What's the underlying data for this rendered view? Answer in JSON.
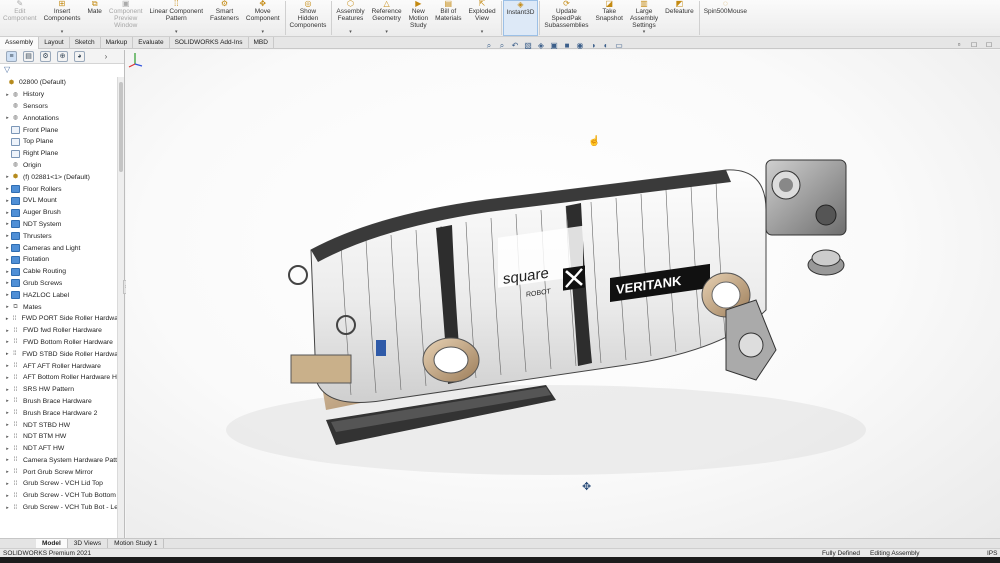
{
  "ribbon": {
    "buttons": [
      {
        "label": "Edit\nComponent",
        "icon": "edit-component-icon",
        "disabled": true
      },
      {
        "label": "Insert\nComponents",
        "icon": "insert-components-icon",
        "disabled": false,
        "dropdown": true
      },
      {
        "label": "Mate",
        "icon": "mate-icon",
        "disabled": false
      },
      {
        "label": "Component\nPreview\nWindow",
        "icon": "component-preview-icon",
        "disabled": true
      },
      {
        "label": "Linear Component\nPattern",
        "icon": "linear-pattern-icon",
        "disabled": false,
        "dropdown": true
      },
      {
        "label": "Smart\nFasteners",
        "icon": "smart-fasteners-icon",
        "disabled": false
      },
      {
        "label": "Move\nComponent",
        "icon": "move-component-icon",
        "disabled": false,
        "dropdown": true
      },
      {
        "label": "Show\nHidden\nComponents",
        "icon": "show-hidden-icon",
        "disabled": false
      },
      {
        "label": "Assembly\nFeatures",
        "icon": "assembly-features-icon",
        "disabled": false,
        "dropdown": true
      },
      {
        "label": "Reference\nGeometry",
        "icon": "reference-geometry-icon",
        "disabled": false,
        "dropdown": true
      },
      {
        "label": "New\nMotion\nStudy",
        "icon": "motion-study-icon",
        "disabled": false
      },
      {
        "label": "Bill of\nMaterials",
        "icon": "bill-of-materials-icon",
        "disabled": false
      },
      {
        "label": "Exploded\nView",
        "icon": "exploded-view-icon",
        "disabled": false,
        "dropdown": true
      },
      {
        "label": "Instant3D",
        "icon": "instant3d-icon",
        "disabled": false,
        "active": true
      },
      {
        "label": "Update\nSpeedPak\nSubassemblies",
        "icon": "speedpak-icon",
        "disabled": false
      },
      {
        "label": "Take\nSnapshot",
        "icon": "snapshot-icon",
        "disabled": false
      },
      {
        "label": "Large\nAssembly\nSettings",
        "icon": "large-assembly-icon",
        "disabled": false,
        "dropdown": true
      },
      {
        "label": "Defeature",
        "icon": "defeature-icon",
        "disabled": false
      },
      {
        "label": "Spin500Mouse",
        "icon": "spin-mouse-icon",
        "disabled": false
      }
    ]
  },
  "command_tabs": [
    "Assembly",
    "Layout",
    "Sketch",
    "Markup",
    "Evaluate",
    "SOLIDWORKS Add-Ins",
    "MBD"
  ],
  "active_command_tab": "Assembly",
  "feature_tree": {
    "nodes": [
      {
        "label": "02800  (Default)",
        "icon": "assembly-icon",
        "kind": "part",
        "expand": false
      },
      {
        "label": "History",
        "icon": "history-icon",
        "kind": "feat",
        "expand": true
      },
      {
        "label": "Sensors",
        "icon": "sensors-icon",
        "kind": "feat",
        "expand": false
      },
      {
        "label": "Annotations",
        "icon": "annotations-icon",
        "kind": "feat",
        "expand": true
      },
      {
        "label": "Front Plane",
        "icon": "plane-icon",
        "kind": "plane",
        "expand": false
      },
      {
        "label": "Top Plane",
        "icon": "plane-icon",
        "kind": "plane",
        "expand": false
      },
      {
        "label": "Right Plane",
        "icon": "plane-icon",
        "kind": "plane",
        "expand": false
      },
      {
        "label": "Origin",
        "icon": "origin-icon",
        "kind": "feat",
        "expand": false
      },
      {
        "label": "(f) 02881<1> (Default)",
        "icon": "part-icon",
        "kind": "part",
        "expand": true
      },
      {
        "label": "Floor Rollers",
        "icon": "folder-icon",
        "kind": "folder",
        "expand": true
      },
      {
        "label": "DVL Mount",
        "icon": "folder-icon",
        "kind": "folder",
        "expand": true
      },
      {
        "label": "Auger Brush",
        "icon": "folder-icon",
        "kind": "folder",
        "expand": true
      },
      {
        "label": "NDT System",
        "icon": "folder-icon",
        "kind": "folder",
        "expand": true
      },
      {
        "label": "Thrusters",
        "icon": "folder-icon",
        "kind": "folder",
        "expand": true
      },
      {
        "label": "Cameras and Light",
        "icon": "folder-icon",
        "kind": "folder",
        "expand": true
      },
      {
        "label": "Flotation",
        "icon": "folder-icon",
        "kind": "folder",
        "expand": true
      },
      {
        "label": "Cable Routing",
        "icon": "folder-icon",
        "kind": "folder",
        "expand": true
      },
      {
        "label": "Grub Screws",
        "icon": "folder-icon",
        "kind": "folder",
        "expand": true
      },
      {
        "label": "HAZLOC Label",
        "icon": "folder-icon",
        "kind": "folder",
        "expand": true
      },
      {
        "label": "Mates",
        "icon": "mates-icon",
        "kind": "mate",
        "expand": true
      },
      {
        "label": "FWD PORT Side Roller Hardwa",
        "icon": "pattern-icon",
        "kind": "pattern",
        "expand": true
      },
      {
        "label": "FWD fwd Roller Hardware",
        "icon": "pattern-icon",
        "kind": "pattern",
        "expand": true
      },
      {
        "label": "FWD Bottom Roller Hardware",
        "icon": "pattern-icon",
        "kind": "pattern",
        "expand": true
      },
      {
        "label": "FWD STBD Side Roller Hardwa",
        "icon": "pattern-icon",
        "kind": "pattern",
        "expand": true
      },
      {
        "label": "AFT AFT Roller Hardware",
        "icon": "pattern-icon",
        "kind": "pattern",
        "expand": true
      },
      {
        "label": "AFT Bottom Roller Hardware H",
        "icon": "pattern-icon",
        "kind": "pattern",
        "expand": true
      },
      {
        "label": "SRS HW Pattern",
        "icon": "pattern-icon",
        "kind": "pattern",
        "expand": true
      },
      {
        "label": "Brush Brace Hardware",
        "icon": "pattern-icon",
        "kind": "pattern",
        "expand": true
      },
      {
        "label": "Brush Brace Hardware 2",
        "icon": "pattern-icon",
        "kind": "pattern",
        "expand": true
      },
      {
        "label": "NDT STBD HW",
        "icon": "pattern-icon",
        "kind": "pattern",
        "expand": true
      },
      {
        "label": "NDT BTM HW",
        "icon": "pattern-icon",
        "kind": "pattern",
        "expand": true
      },
      {
        "label": "NDT AFT HW",
        "icon": "pattern-icon",
        "kind": "pattern",
        "expand": true
      },
      {
        "label": "Camera System Hardware Patt",
        "icon": "pattern-icon",
        "kind": "pattern",
        "expand": true
      },
      {
        "label": "Port Grub Screw Mirror",
        "icon": "mirror-icon",
        "kind": "pattern",
        "expand": true
      },
      {
        "label": "Grub Screw - VCH Lid Top",
        "icon": "pattern-icon",
        "kind": "pattern",
        "expand": true
      },
      {
        "label": "Grub Screw - VCH Tub Bottom",
        "icon": "pattern-icon",
        "kind": "pattern",
        "expand": true
      },
      {
        "label": "Grub Screw - VCH Tub Bot - Le",
        "icon": "pattern-icon",
        "kind": "pattern",
        "expand": true
      }
    ]
  },
  "model_labels": {
    "brand1": "square",
    "brand1_sub": "ROBOT",
    "brand2": "VERITANK"
  },
  "bottom_tabs": [
    "Model",
    "3D Views",
    "Motion Study 1"
  ],
  "active_bottom_tab": "Model",
  "status_bar": {
    "product": "SOLIDWORKS Premium 2021",
    "state1": "Fully Defined",
    "state2": "Editing Assembly",
    "units": "IPS"
  }
}
